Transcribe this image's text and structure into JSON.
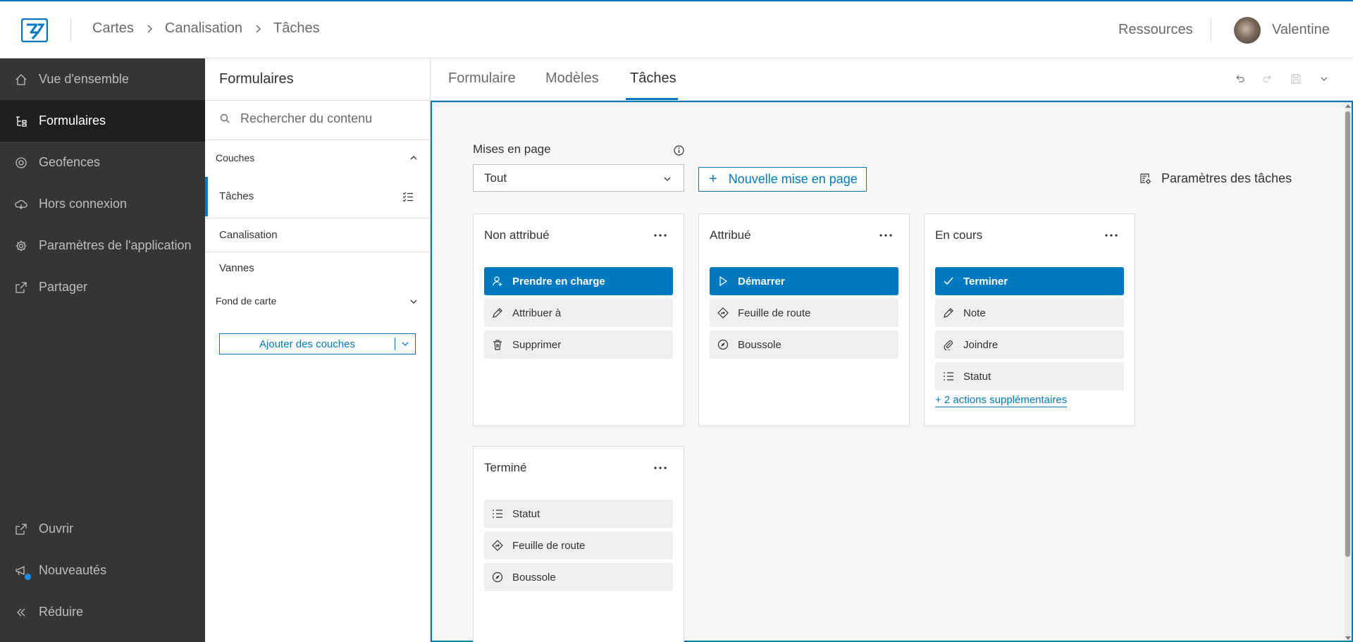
{
  "colors": {
    "accent": "#0079c1",
    "nav_bg": "#353535",
    "nav_active": "#1f1f1f",
    "canvas_bg": "#f7f7f7"
  },
  "header": {
    "logo_icon": "app-logo-icon",
    "breadcrumbs": [
      "Cartes",
      "Canalisation",
      "Tâches"
    ],
    "resources": "Ressources",
    "user": "Valentine"
  },
  "leftnav": {
    "items": [
      {
        "label": "Vue d'ensemble",
        "icon": "home-icon"
      },
      {
        "label": "Formulaires",
        "icon": "form-tree-icon"
      },
      {
        "label": "Geofences",
        "icon": "geofence-icon"
      },
      {
        "label": "Hors connexion",
        "icon": "offline-cloud-icon"
      },
      {
        "label": "Paramètres de l'application",
        "icon": "gear-icon"
      },
      {
        "label": "Partager",
        "icon": "share-icon"
      }
    ],
    "active_index": 1,
    "bottom": [
      {
        "label": "Ouvrir",
        "icon": "launch-icon"
      },
      {
        "label": "Nouveautés",
        "icon": "megaphone-icon"
      },
      {
        "label": "Réduire",
        "icon": "collapse-icon"
      }
    ]
  },
  "forms_panel": {
    "title": "Formulaires",
    "search_placeholder": "Rechercher du contenu",
    "layers_group": "Couches",
    "layers": [
      "Tâches",
      "Canalisation",
      "Vannes"
    ],
    "selected_layer_index": 0,
    "basemap_group": "Fond de carte",
    "add_layers": "Ajouter des couches"
  },
  "tabs": {
    "items": [
      "Formulaire",
      "Modèles",
      "Tâches"
    ],
    "active_index": 2
  },
  "toolbar": {
    "icons": [
      "undo-icon",
      "redo-icon",
      "save-icon",
      "chevron-down-icon"
    ]
  },
  "layouts": {
    "label": "Mises en page",
    "selected": "Tout",
    "new_layout": "Nouvelle mise en page",
    "task_settings": "Paramètres des tâches"
  },
  "cards": [
    {
      "title": "Non attribué",
      "actions": [
        {
          "label": "Prendre en charge",
          "icon": "user-add-icon",
          "primary": true
        },
        {
          "label": "Attribuer à",
          "icon": "pencil-icon",
          "primary": false
        },
        {
          "label": "Supprimer",
          "icon": "trash-icon",
          "primary": false
        }
      ]
    },
    {
      "title": "Attribué",
      "actions": [
        {
          "label": "Démarrer",
          "icon": "play-icon",
          "primary": true
        },
        {
          "label": "Feuille de route",
          "icon": "directions-icon",
          "primary": false
        },
        {
          "label": "Boussole",
          "icon": "compass-icon",
          "primary": false
        }
      ]
    },
    {
      "title": "En cours",
      "actions": [
        {
          "label": "Terminer",
          "icon": "check-icon",
          "primary": true
        },
        {
          "label": "Note",
          "icon": "pencil-icon",
          "primary": false
        },
        {
          "label": "Joindre",
          "icon": "paperclip-icon",
          "primary": false
        },
        {
          "label": "Statut",
          "icon": "list-icon",
          "primary": false
        }
      ],
      "more": "+ 2 actions supplémentaires"
    },
    {
      "title": "Terminé",
      "actions": [
        {
          "label": "Statut",
          "icon": "list-icon",
          "primary": false
        },
        {
          "label": "Feuille de route",
          "icon": "directions-icon",
          "primary": false
        },
        {
          "label": "Boussole",
          "icon": "compass-icon",
          "primary": false
        }
      ]
    }
  ]
}
